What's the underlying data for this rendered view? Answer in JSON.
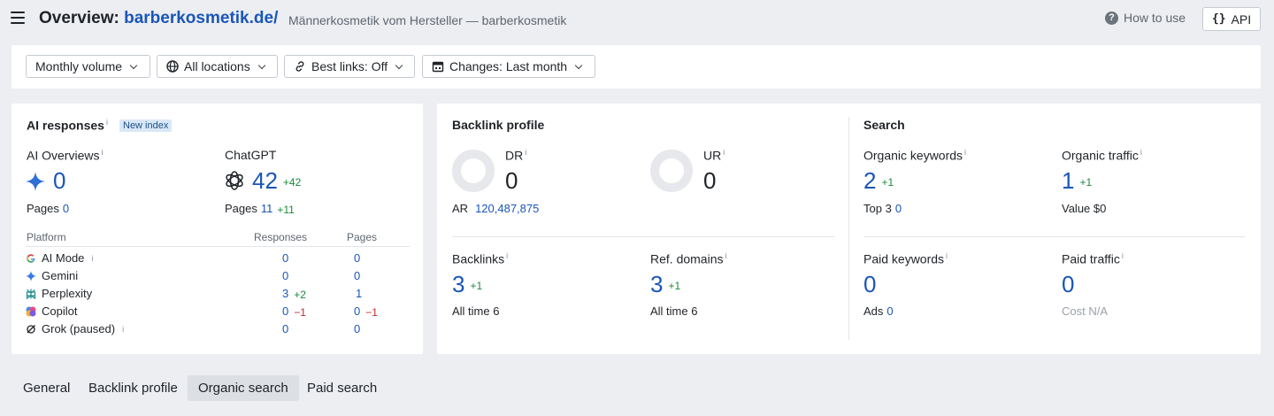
{
  "header": {
    "title_prefix": "Overview: ",
    "title_domain": "barberkosmetik.de/",
    "subtitle": "Männerkosmetik vom Hersteller — barberkosmetik",
    "how_to_use": "How to use",
    "api": "API",
    "api_braces": "{}"
  },
  "filters": [
    {
      "label": "Monthly volume"
    },
    {
      "label": "All locations"
    },
    {
      "label": "Best links: Off"
    },
    {
      "label": "Changes: Last month"
    }
  ],
  "ai_responses": {
    "title": "AI responses",
    "info": "i",
    "badge": "New index",
    "ai_overviews": {
      "label": "AI Overviews",
      "value": "0",
      "pages_label": "Pages",
      "pages_value": "0"
    },
    "chatgpt": {
      "label": "ChatGPT",
      "value": "42",
      "delta": "+42",
      "pages_label": "Pages",
      "pages_value": "11",
      "pages_delta": "+11"
    },
    "table": {
      "headers": {
        "platform": "Platform",
        "responses": "Responses",
        "pages": "Pages"
      },
      "rows": [
        {
          "name": "AI Mode",
          "info": "i",
          "responses": "0",
          "responses_delta": "",
          "pages": "0",
          "pages_delta": "",
          "icon": "google-icon"
        },
        {
          "name": "Gemini",
          "info": "",
          "responses": "0",
          "responses_delta": "",
          "pages": "0",
          "pages_delta": "",
          "icon": "gemini-icon"
        },
        {
          "name": "Perplexity",
          "info": "",
          "responses": "3",
          "responses_delta": "+2",
          "pages": "1",
          "pages_delta": "",
          "icon": "perplexity-icon"
        },
        {
          "name": "Copilot",
          "info": "",
          "responses": "0",
          "responses_delta": "−1",
          "pages": "0",
          "pages_delta": "−1",
          "icon": "copilot-icon"
        },
        {
          "name": "Grok (paused)",
          "info": "i",
          "responses": "0",
          "responses_delta": "",
          "pages": "0",
          "pages_delta": "",
          "icon": "grok-icon"
        }
      ]
    }
  },
  "backlink_profile": {
    "title": "Backlink profile",
    "dr": {
      "label": "DR",
      "value": "0",
      "ar_label": "AR",
      "ar_value": "120,487,875"
    },
    "ur": {
      "label": "UR",
      "value": "0"
    },
    "backlinks": {
      "label": "Backlinks",
      "value": "3",
      "delta": "+1",
      "sub_label": "All time",
      "sub_value": "6"
    },
    "ref_domains": {
      "label": "Ref. domains",
      "value": "3",
      "delta": "+1",
      "sub_label": "All time",
      "sub_value": "6"
    }
  },
  "search": {
    "title": "Search",
    "organic_keywords": {
      "label": "Organic keywords",
      "value": "2",
      "delta": "+1",
      "sub_label": "Top 3",
      "sub_value": "0"
    },
    "organic_traffic": {
      "label": "Organic traffic",
      "value": "1",
      "delta": "+1",
      "sub_label": "Value",
      "sub_value": "$0"
    },
    "paid_keywords": {
      "label": "Paid keywords",
      "value": "0",
      "sub_label": "Ads",
      "sub_value": "0"
    },
    "paid_traffic": {
      "label": "Paid traffic",
      "value": "0",
      "sub_label": "Cost",
      "sub_value": "N/A"
    }
  },
  "tabs": [
    {
      "label": "General",
      "active": false
    },
    {
      "label": "Backlink profile",
      "active": false
    },
    {
      "label": "Organic search",
      "active": true
    },
    {
      "label": "Paid search",
      "active": false
    }
  ],
  "colors": {
    "link": "#1a56b8",
    "positive": "#1a8a3a",
    "negative": "#c62828",
    "badge_bg": "#d9e8f7"
  }
}
